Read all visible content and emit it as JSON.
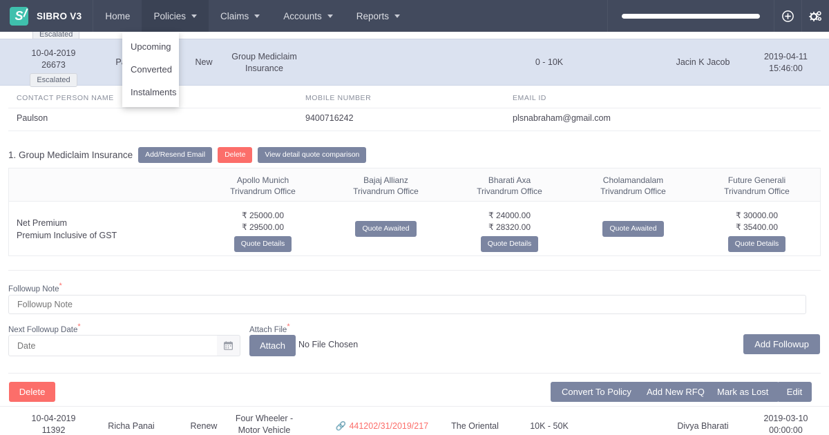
{
  "app": {
    "brand": "SIBRO V3",
    "logo_letter": "S",
    "logo_color": "#3fc0ad",
    "navbar_color": "#424a5d",
    "accent_danger": "#fc6e6a",
    "accent_button": "#7b85a1"
  },
  "nav": {
    "items": [
      {
        "label": "Home",
        "has_caret": false,
        "active": false
      },
      {
        "label": "Policies",
        "has_caret": true,
        "active": true
      },
      {
        "label": "Claims",
        "has_caret": true,
        "active": false
      },
      {
        "label": "Accounts",
        "has_caret": true,
        "active": false
      },
      {
        "label": "Reports",
        "has_caret": true,
        "active": false
      }
    ],
    "search_placeholder": "",
    "search_value": "",
    "icons": [
      "plus-circle-icon",
      "cogs-icon"
    ]
  },
  "dropdown": {
    "parent": "Policies",
    "items": [
      "Upcoming",
      "Converted",
      "Instalments"
    ]
  },
  "partial_row_above": {
    "badge": "Escalated"
  },
  "lead_row": {
    "date": "10-04-2019",
    "id": "26673",
    "badge": "Escalated",
    "customer": "Paulson",
    "type": "New",
    "product": "Group Mediclaim Insurance",
    "premium_range": "0 - 10K",
    "assigned_to": "Jacin K Jacob",
    "timestamp_date": "2019-04-11",
    "timestamp_time": "15:46:00"
  },
  "contact": {
    "headers": [
      "CONTACT PERSON NAME",
      "MOBILE NUMBER",
      "EMAIL ID"
    ],
    "values": [
      "Paulson",
      "9400716242",
      "plsnabraham@gmail.com"
    ]
  },
  "quote_section": {
    "title": "1. Group Mediclaim Insurance",
    "buttons": [
      {
        "label": "Add/Resend Email",
        "style": "default"
      },
      {
        "label": "Delete",
        "style": "danger"
      },
      {
        "label": "View detail quote comparison",
        "style": "default"
      }
    ],
    "row_labels": [
      "Net Premium",
      "Premium Inclusive of GST"
    ],
    "awaited_label": "Quote Awaited",
    "details_label": "Quote Details",
    "insurers": [
      {
        "name": "Apollo Munich",
        "office": "Trivandrum Office",
        "status": "quoted",
        "net_premium": "₹ 25000.00",
        "premium_with_gst": "₹ 29500.00"
      },
      {
        "name": "Bajaj Allianz",
        "office": "Trivandrum Office",
        "status": "awaited",
        "net_premium": "",
        "premium_with_gst": ""
      },
      {
        "name": "Bharati Axa",
        "office": "Trivandrum Office",
        "status": "quoted",
        "net_premium": "₹ 24000.00",
        "premium_with_gst": "₹ 28320.00"
      },
      {
        "name": "Cholamandalam",
        "office": "Trivandrum Office",
        "status": "awaited",
        "net_premium": "",
        "premium_with_gst": ""
      },
      {
        "name": "Future Generali",
        "office": "Trivandrum Office",
        "status": "quoted",
        "net_premium": "₹ 30000.00",
        "premium_with_gst": "₹ 35400.00"
      }
    ]
  },
  "followup_form": {
    "note_label": "Followup Note",
    "note_placeholder": "Followup Note",
    "note_value": "",
    "date_label": "Next Followup Date",
    "date_placeholder": "Date",
    "date_value": "",
    "calendar_icon": "calendar-icon",
    "attach_label": "Attach File",
    "attach_button": "Attach",
    "file_status": "No File Chosen",
    "add_followup_button": "Add Followup"
  },
  "actions": {
    "delete": "Delete",
    "convert_to_policy": "Convert To Policy",
    "add_new_rfq": "Add New RFQ",
    "mark_as_lost": "Mark as Lost",
    "edit": "Edit"
  },
  "bottom_row": {
    "date": "10-04-2019",
    "id": "11392",
    "customer": "Richa Panai",
    "type": "Renew",
    "product": "Four Wheeler - Motor Vehicle",
    "policy_number": "441202/31/2019/217",
    "insurer": "The Oriental",
    "premium_range": "10K - 50K",
    "assigned_to": "Divya Bharati",
    "timestamp_date": "2019-03-10",
    "timestamp_time": "00:00:00"
  }
}
